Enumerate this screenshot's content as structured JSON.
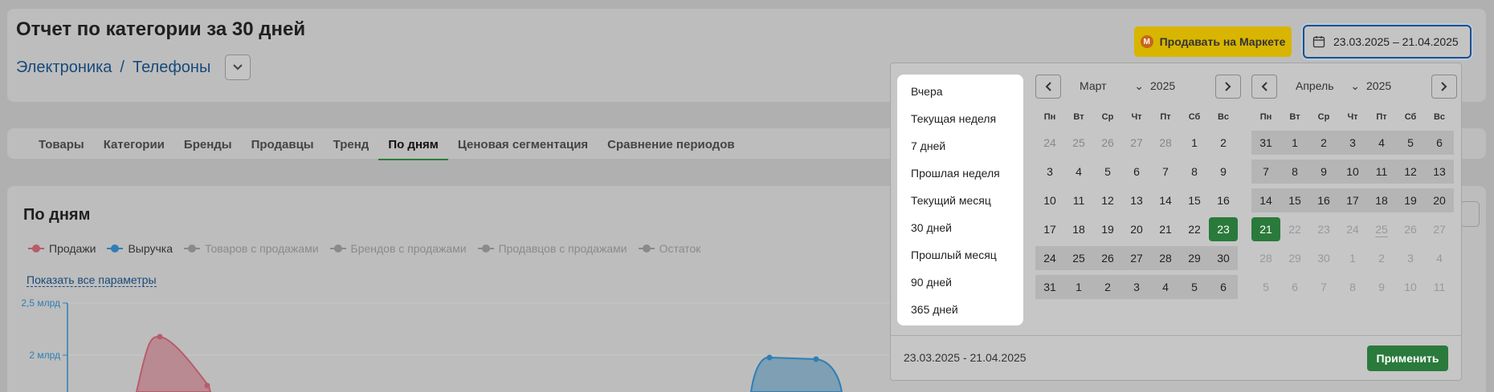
{
  "header": {
    "title": "Отчет по категории за 30 дней",
    "breadcrumb": [
      "Электроника",
      "Телефоны"
    ],
    "breadcrumb_sep": "/",
    "sell_button": "Продавать на Маркете",
    "sell_logo": "М",
    "date_range": "23.03.2025 – 21.04.2025"
  },
  "tabs": [
    "Товары",
    "Категории",
    "Бренды",
    "Продавцы",
    "Тренд",
    "По дням",
    "Ценовая сегментация",
    "Сравнение периодов"
  ],
  "active_tab": "По дням",
  "chart": {
    "title": "По дням",
    "legend": [
      {
        "label": "Продажи",
        "color": "#b85c6a",
        "active": true
      },
      {
        "label": "Выручка",
        "color": "#2d7fb5",
        "active": true
      },
      {
        "label": "Товаров с продажами",
        "color": "#8a8a8a",
        "active": false
      },
      {
        "label": "Брендов с продажами",
        "color": "#8a8a8a",
        "active": false
      },
      {
        "label": "Продавцов с продажами",
        "color": "#8a8a8a",
        "active": false
      },
      {
        "label": "Остаток",
        "color": "#8a8a8a",
        "active": false
      }
    ],
    "show_all": "Показать все параметры",
    "y_ticks": [
      "2,5 млрд",
      "2 млрд"
    ]
  },
  "popup": {
    "presets": [
      "Вчера",
      "Текущая неделя",
      "7 дней",
      "Прошлая неделя",
      "Текущий месяц",
      "30 дней",
      "Прошлый месяц",
      "90 дней",
      "365 дней"
    ],
    "weekdays": [
      "Пн",
      "Вт",
      "Ср",
      "Чт",
      "Пт",
      "Сб",
      "Вс"
    ],
    "left_month": "Март",
    "left_year": "2025",
    "right_month": "Апрель",
    "right_year": "2025",
    "left_days": [
      "24",
      "25",
      "26",
      "27",
      "28",
      "1",
      "2",
      "3",
      "4",
      "5",
      "6",
      "7",
      "8",
      "9",
      "10",
      "11",
      "12",
      "13",
      "14",
      "15",
      "16",
      "17",
      "18",
      "19",
      "20",
      "21",
      "22",
      "23",
      "24",
      "25",
      "26",
      "27",
      "28",
      "29",
      "30",
      "31",
      "1",
      "2",
      "3",
      "4",
      "5",
      "6"
    ],
    "right_days": [
      "31",
      "1",
      "2",
      "3",
      "4",
      "5",
      "6",
      "7",
      "8",
      "9",
      "10",
      "11",
      "12",
      "13",
      "14",
      "15",
      "16",
      "17",
      "18",
      "19",
      "20",
      "21",
      "22",
      "23",
      "24",
      "25",
      "26",
      "27",
      "28",
      "29",
      "30",
      "1",
      "2",
      "3",
      "4",
      "5",
      "6",
      "7",
      "8",
      "9",
      "10",
      "11"
    ],
    "footer_range": "23.03.2025 - 21.04.2025",
    "apply": "Применить"
  },
  "colors": {
    "accent_green": "#2a7a3c",
    "link_blue": "#174a7a",
    "yellow": "#d8b500"
  }
}
